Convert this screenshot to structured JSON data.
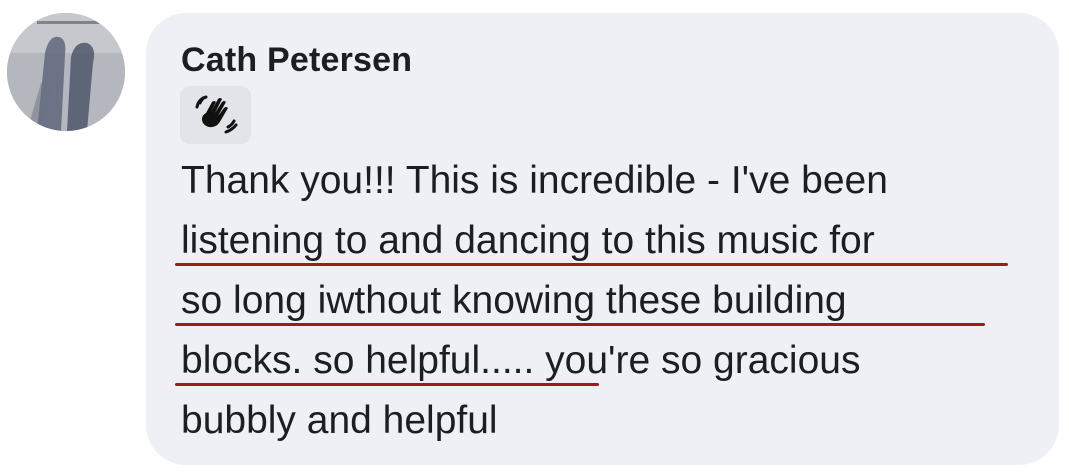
{
  "comment": {
    "author": "Cath Petersen",
    "badge_icon": "waving-hand-icon",
    "lines": [
      "Thank you!!! This is incredible - I've been",
      "listening to and dancing to this music for",
      "so long iwthout knowing these building",
      "blocks. so helpful..... you're so gracious",
      "bubbly and helpful"
    ],
    "highlighted_text": "listening to and dancing to this music for so long iwthout knowing these building blocks. so helpful.....",
    "highlight_color": "#a01a1a"
  },
  "colors": {
    "bubble_background": "#eff0f5",
    "text": "#1c1e21",
    "badge_background": "#e2e4e9"
  }
}
